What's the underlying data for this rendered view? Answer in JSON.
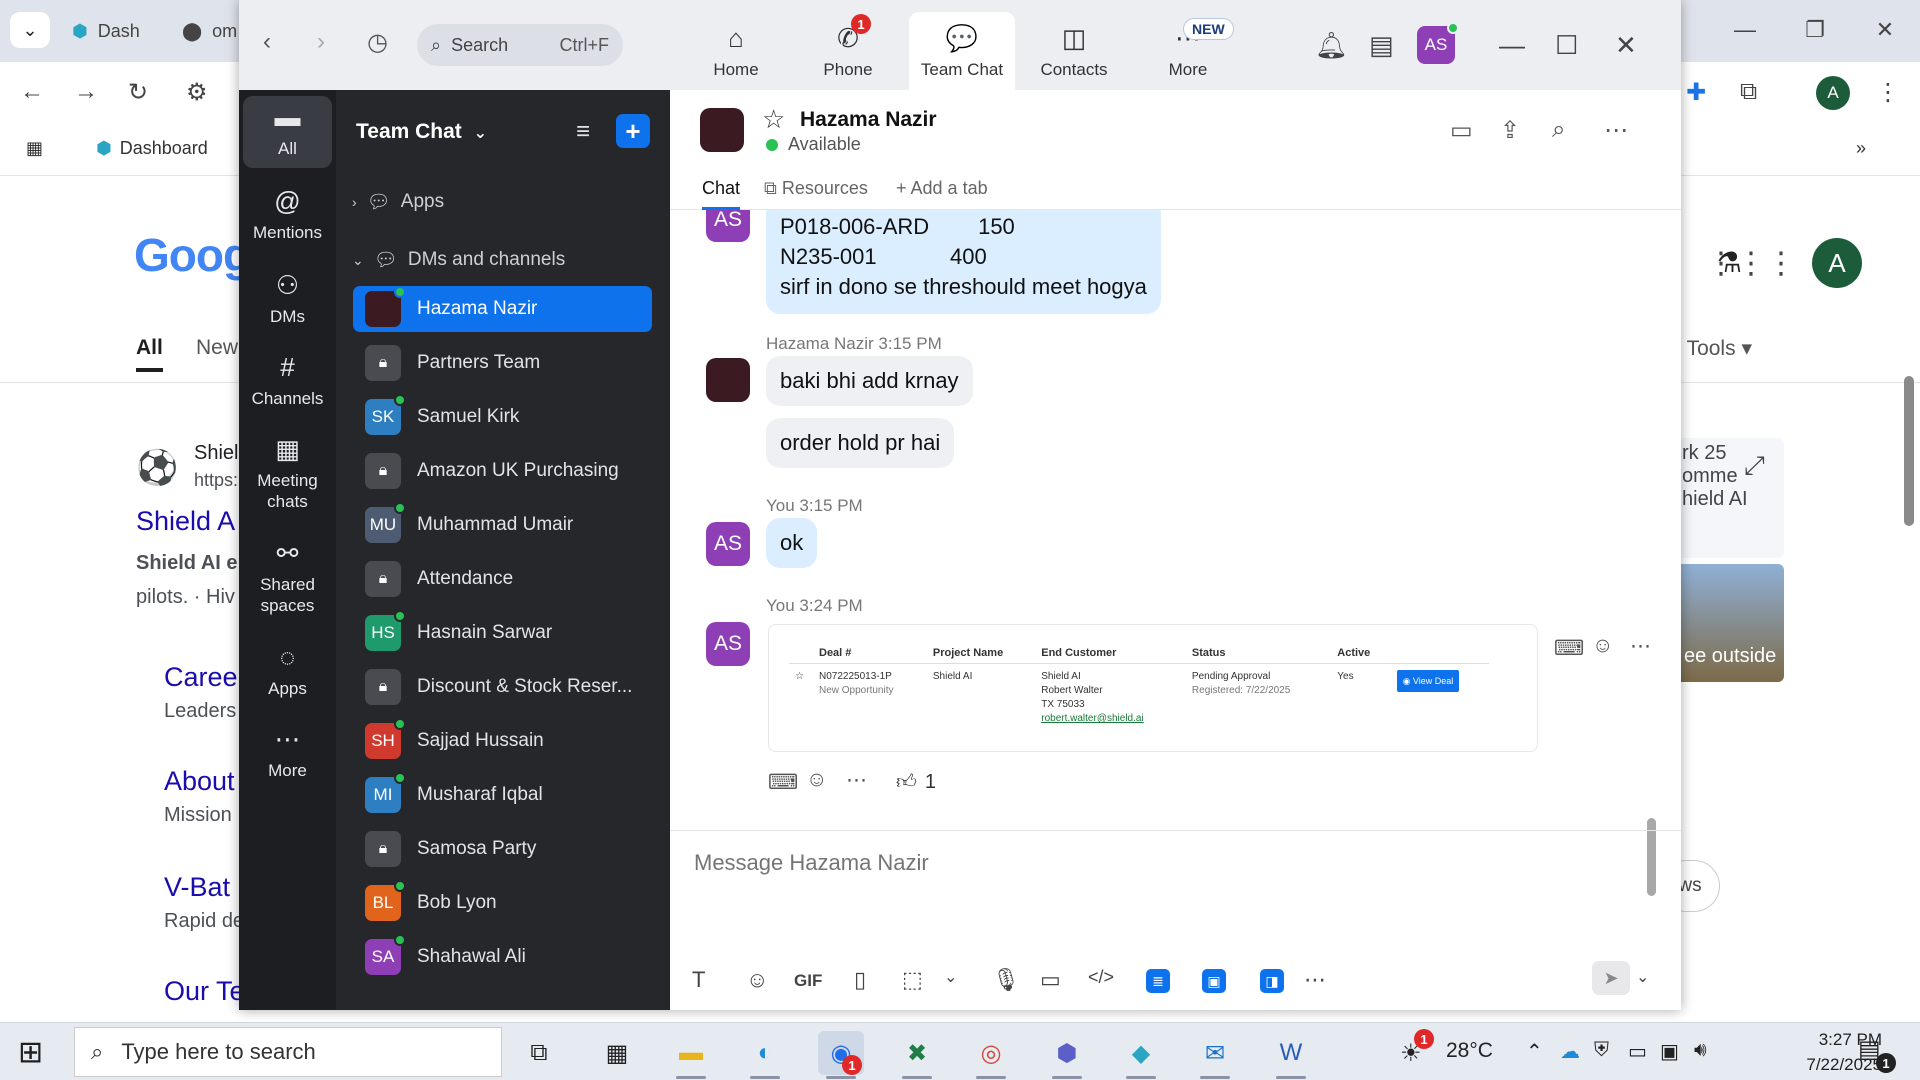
{
  "browser": {
    "tabs": [
      {
        "label": "Dash"
      },
      {
        "label": "om"
      }
    ],
    "bookmarks": {
      "dashboard": "Dashboard"
    },
    "profile_initial": "A"
  },
  "google": {
    "logo": "Goog",
    "tabs": [
      "All",
      "New"
    ],
    "tools": "Tools",
    "profile_initial": "A",
    "result": {
      "site": "Shiel",
      "url": "https:",
      "title": "Shield A",
      "snippet_1": "Shield AI e",
      "snippet_2": "pilots. · Hiv"
    },
    "sublinks": [
      {
        "title": "Caree",
        "desc": "Leaders"
      },
      {
        "title": "About",
        "desc": "Mission"
      },
      {
        "title": "V-Bat",
        "desc": "Rapid de"
      },
      {
        "title": "Our Te",
        "desc": ""
      }
    ],
    "side": {
      "line1": "rk 25",
      "line2": "omme",
      "line3": "hield AI",
      "thumb_caption": "ee outside",
      "pill": "ws"
    }
  },
  "zoom": {
    "search": {
      "placeholder": "Search",
      "shortcut": "Ctrl+F"
    },
    "top_tabs": [
      {
        "label": "Home",
        "icon": "home-icon"
      },
      {
        "label": "Phone",
        "icon": "phone-icon",
        "badge": "1"
      },
      {
        "label": "Team Chat",
        "icon": "chat-icon"
      },
      {
        "label": "Contacts",
        "icon": "contacts-icon"
      },
      {
        "label": "More",
        "icon": "more-icon",
        "badge": "NEW"
      }
    ],
    "user_initials": "AS",
    "rail": [
      {
        "label": "All"
      },
      {
        "label": "Mentions"
      },
      {
        "label": "DMs"
      },
      {
        "label": "Channels"
      },
      {
        "label": "Meeting chats"
      },
      {
        "label": "Shared spaces"
      },
      {
        "label": "Apps"
      },
      {
        "label": "More"
      }
    ],
    "sidebar": {
      "title": "Team Chat",
      "apps_section": "Apps",
      "dms_section": "DMs and channels",
      "items": [
        {
          "name": "Hazama Nazir",
          "initials": "",
          "color": "#3b1a22",
          "type": "dm",
          "online": true
        },
        {
          "name": "Partners Team",
          "initials": "",
          "color": "#4a4b51",
          "type": "channel",
          "online": false
        },
        {
          "name": "Samuel Kirk",
          "initials": "SK",
          "color": "#2d7fc1",
          "type": "dm",
          "online": true
        },
        {
          "name": "Amazon UK Purchasing",
          "initials": "",
          "color": "#4a4b51",
          "type": "channel",
          "online": false
        },
        {
          "name": "Muhammad Umair",
          "initials": "MU",
          "color": "#4d5c72",
          "type": "dm",
          "online": true
        },
        {
          "name": "Attendance",
          "initials": "",
          "color": "#4a4b51",
          "type": "channel",
          "online": false
        },
        {
          "name": "Hasnain Sarwar",
          "initials": "HS",
          "color": "#1f9a6b",
          "type": "dm",
          "online": true
        },
        {
          "name": "Discount & Stock Reser...",
          "initials": "",
          "color": "#4a4b51",
          "type": "channel",
          "online": false
        },
        {
          "name": "Sajjad Hussain",
          "initials": "SH",
          "color": "#d0392e",
          "type": "dm",
          "online": true
        },
        {
          "name": "Musharaf Iqbal",
          "initials": "MI",
          "color": "#2d7fc1",
          "type": "dm",
          "online": true
        },
        {
          "name": "Samosa Party",
          "initials": "",
          "color": "#4a4b51",
          "type": "channel",
          "online": false
        },
        {
          "name": "Bob Lyon",
          "initials": "BL",
          "color": "#e0641c",
          "type": "dm",
          "online": true
        },
        {
          "name": "Shahawal Ali",
          "initials": "SA",
          "color": "#8e3fb6",
          "type": "dm",
          "online": true
        }
      ]
    },
    "chat": {
      "contact_name": "Hazama Nazir",
      "status": "Available",
      "tabs": [
        "Chat",
        "Resources",
        "Add a tab"
      ],
      "messages": {
        "m1_lines": [
          "P018-006-ARD        150",
          "N235-001            400",
          "sirf in dono se threshould meet hogya"
        ],
        "m2_meta": "Hazama Nazir  3:15 PM",
        "m2_a": "baki bhi add krnay",
        "m2_b": "order hold pr hai",
        "m3_meta": "You  3:15 PM",
        "m3_text": "ok",
        "m4_meta": "You  3:24 PM",
        "reaction_count": "1"
      },
      "attachment": {
        "headers": [
          "Deal #",
          "Project Name",
          "End Customer",
          "Status",
          "Active"
        ],
        "deal_no": "N072225013-1P",
        "deal_sub": "New Opportunity",
        "project": "Shield AI",
        "customer": [
          "Shield AI",
          "Robert Walter",
          "TX 75033"
        ],
        "email": "robert.walter@shield.ai",
        "status": "Pending Approval",
        "registered": "Registered: 7/22/2025",
        "active": "Yes",
        "button": "View Deal"
      },
      "composer_placeholder": "Message Hazama Nazir"
    }
  },
  "taskbar": {
    "search_placeholder": "Type here to search",
    "weather": "28°C",
    "time": "3:27 PM",
    "date": "7/22/2025",
    "zoom_badge": "1",
    "weather_badge": "1",
    "notif_badge": "1"
  }
}
